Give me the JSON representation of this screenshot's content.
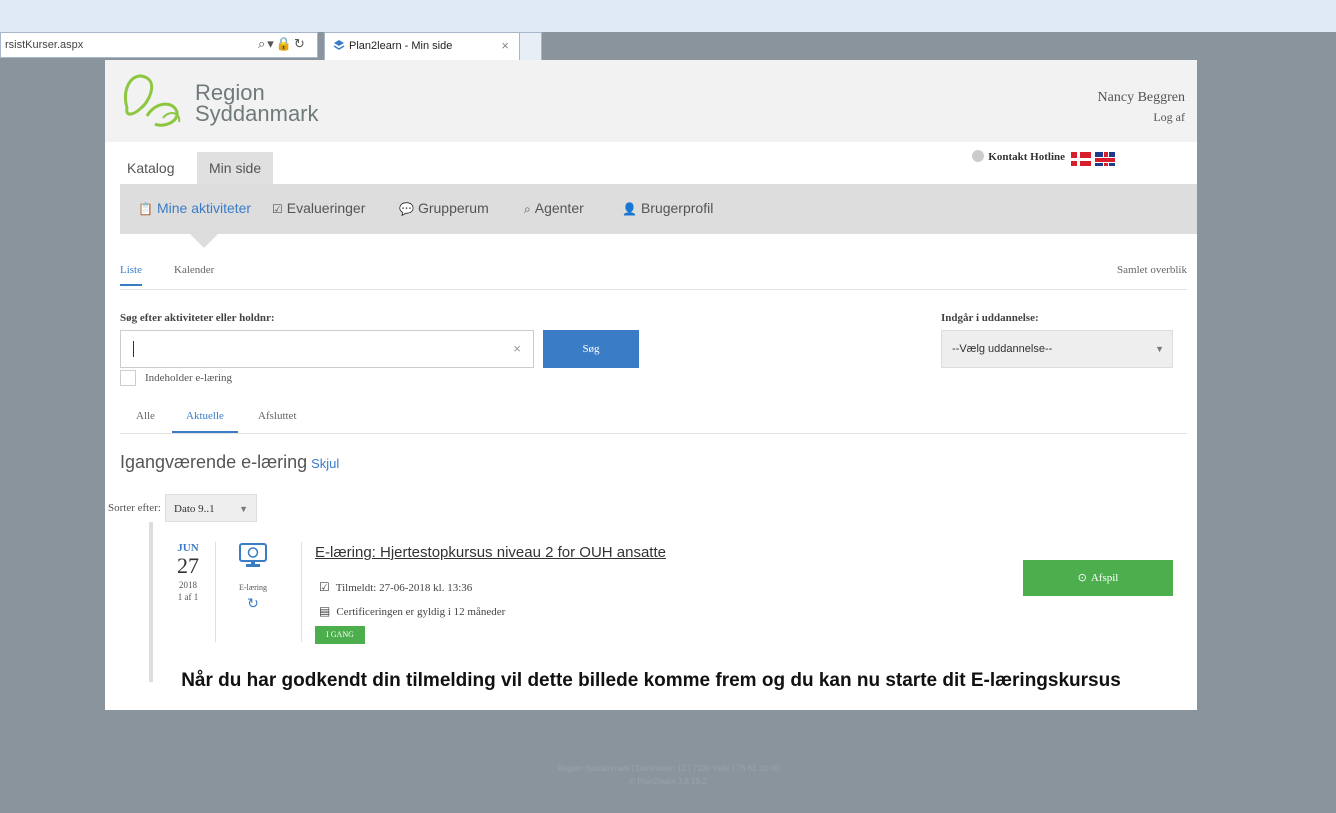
{
  "browser": {
    "address": "rsistKurser.aspx",
    "tab_title": "Plan2learn - Min side",
    "tab_close": "×"
  },
  "header": {
    "logo_line1": "Region",
    "logo_line2": "Syddanmark",
    "user_name": "Nancy Beggren",
    "logout": "Log af"
  },
  "main_tabs": {
    "katalog": "Katalog",
    "min_side": "Min side",
    "hotline": "Kontakt Hotline"
  },
  "subnav": {
    "items": [
      {
        "label": "Mine aktiviteter",
        "icon": "clipboard-icon"
      },
      {
        "label": "Evalueringer",
        "icon": "checkbox-icon"
      },
      {
        "label": "Grupperum",
        "icon": "chat-icon"
      },
      {
        "label": "Agenter",
        "icon": "search-icon"
      },
      {
        "label": "Brugerprofil",
        "icon": "person-icon"
      }
    ]
  },
  "view_tabs": {
    "liste": "Liste",
    "kalender": "Kalender",
    "overview": "Samlet overblik"
  },
  "search": {
    "label": "Søg efter aktiviteter eller holdnr:",
    "value": "",
    "clear": "×",
    "button": "Søg",
    "checkbox_label": "Indeholder e-læring"
  },
  "education": {
    "label": "Indgår i uddannelse:",
    "selected": "--Vælg uddannelse--"
  },
  "filter_tabs": {
    "alle": "Alle",
    "aktuelle": "Aktuelle",
    "afsluttet": "Afsluttet"
  },
  "section": {
    "title": "Igangværende e-læring",
    "hide": "Skjul"
  },
  "sort": {
    "label": "Sorter efter:",
    "selected": "Dato 9..1"
  },
  "course": {
    "month": "JUN",
    "day": "27",
    "year": "2018",
    "count": "1 af 1",
    "type": "E-læring",
    "title": "E-læring: Hjertestopkursus niveau 2 for OUH ansatte",
    "enrolled": "Tilmeldt: 27-06-2018 kl. 13:36",
    "certificate": "Certificeringen er gyldig i 12 måneder",
    "status": "I GANG",
    "play_button": "Afspil"
  },
  "caption": "Når du har godkendt din tilmelding vil dette billede komme frem og du kan nu starte dit E-læringskursus",
  "footer": {
    "line1": "Region Syddanmark | Damhaven 12 | 7100 Vejle | 76 63 10 00",
    "line2": "© Plan2learn 3.8.19.2"
  },
  "colors": {
    "accent": "#3b7cc7",
    "success": "#4cae4c",
    "background": "#8a949c"
  }
}
